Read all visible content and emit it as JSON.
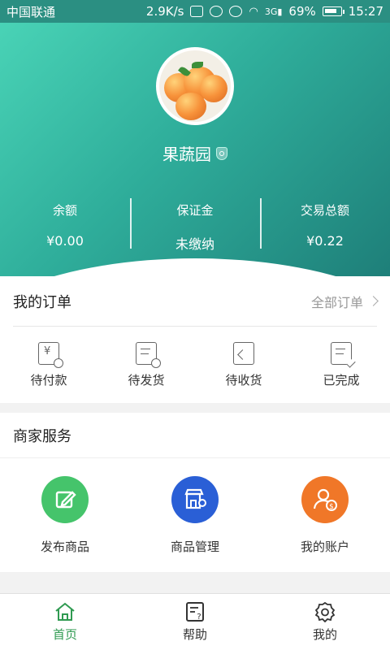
{
  "status_bar": {
    "carrier": "中国联通",
    "speed": "2.9K/s",
    "network": "3G",
    "battery": "69%",
    "time": "15:27"
  },
  "profile": {
    "shop_name": "果蔬园",
    "verified_icon": "shield-user-icon",
    "avatar_icon": "peaches-avatar"
  },
  "stats": [
    {
      "label": "余额",
      "value": "¥0.00"
    },
    {
      "label": "保证金",
      "value": "未缴纳"
    },
    {
      "label": "交易总额",
      "value": "¥0.22"
    }
  ],
  "orders": {
    "title": "我的订单",
    "all_label": "全部订单",
    "items": [
      {
        "label": "待付款",
        "icon": "pending-payment-icon"
      },
      {
        "label": "待发货",
        "icon": "pending-shipment-icon"
      },
      {
        "label": "待收货",
        "icon": "pending-receipt-icon"
      },
      {
        "label": "已完成",
        "icon": "completed-icon"
      }
    ]
  },
  "services": {
    "title": "商家服务",
    "items": [
      {
        "label": "发布商品",
        "icon": "edit-icon",
        "color": "#45c46b"
      },
      {
        "label": "商品管理",
        "icon": "store-settings-icon",
        "color": "#2a5fd6"
      },
      {
        "label": "我的账户",
        "icon": "account-icon",
        "color": "#f07728"
      }
    ]
  },
  "bottom_nav": [
    {
      "label": "首页",
      "icon": "home-icon",
      "active": true
    },
    {
      "label": "帮助",
      "icon": "help-icon",
      "active": false
    },
    {
      "label": "我的",
      "icon": "settings-icon",
      "active": false
    }
  ],
  "colors": {
    "header_start": "#49d3b6",
    "header_end": "#1e7f79",
    "active_tab": "#2f9a51"
  }
}
